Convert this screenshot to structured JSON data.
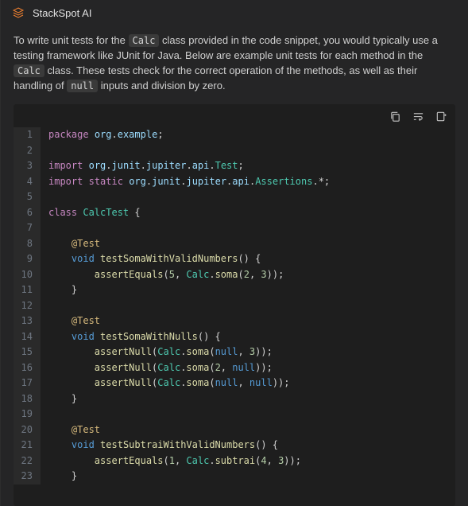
{
  "header": {
    "title": "StackSpot AI"
  },
  "description": {
    "t1": "To write unit tests for the ",
    "c1": "Calc",
    "t2": " class provided in the code snippet, you would typically use a testing framework like JUnit for Java. Below are example unit tests for each method in the ",
    "c2": "Calc",
    "t3": " class. These tests check for the correct operation of the methods, as well as their handling of ",
    "c3": "null",
    "t4": " inputs and division by zero."
  },
  "chart_data": {
    "type": "table",
    "language": "java",
    "lines": [
      {
        "n": 1,
        "tokens": [
          [
            "package",
            "kw"
          ],
          [
            " ",
            "p"
          ],
          [
            "org",
            "pkg"
          ],
          [
            ".",
            "p"
          ],
          [
            "example",
            "pkg"
          ],
          [
            ";",
            "p"
          ]
        ]
      },
      {
        "n": 2,
        "tokens": []
      },
      {
        "n": 3,
        "tokens": [
          [
            "import",
            "kw"
          ],
          [
            " ",
            "p"
          ],
          [
            "org",
            "pkg"
          ],
          [
            ".",
            "p"
          ],
          [
            "junit",
            "pkg"
          ],
          [
            ".",
            "p"
          ],
          [
            "jupiter",
            "pkg"
          ],
          [
            ".",
            "p"
          ],
          [
            "api",
            "pkg"
          ],
          [
            ".",
            "p"
          ],
          [
            "Test",
            "cls"
          ],
          [
            ";",
            "p"
          ]
        ]
      },
      {
        "n": 4,
        "tokens": [
          [
            "import",
            "kw"
          ],
          [
            " ",
            "p"
          ],
          [
            "static",
            "kw"
          ],
          [
            " ",
            "p"
          ],
          [
            "org",
            "pkg"
          ],
          [
            ".",
            "p"
          ],
          [
            "junit",
            "pkg"
          ],
          [
            ".",
            "p"
          ],
          [
            "jupiter",
            "pkg"
          ],
          [
            ".",
            "p"
          ],
          [
            "api",
            "pkg"
          ],
          [
            ".",
            "p"
          ],
          [
            "Assertions",
            "cls"
          ],
          [
            ".",
            "p"
          ],
          [
            "*",
            "star"
          ],
          [
            ";",
            "p"
          ]
        ]
      },
      {
        "n": 5,
        "tokens": []
      },
      {
        "n": 6,
        "tokens": [
          [
            "class",
            "kw"
          ],
          [
            " ",
            "p"
          ],
          [
            "CalcTest",
            "cls"
          ],
          [
            " {",
            "p"
          ]
        ]
      },
      {
        "n": 7,
        "tokens": []
      },
      {
        "n": 8,
        "tokens": [
          [
            "    ",
            "p"
          ],
          [
            "@Test",
            "ann"
          ]
        ]
      },
      {
        "n": 9,
        "tokens": [
          [
            "    ",
            "p"
          ],
          [
            "void",
            "lit"
          ],
          [
            " ",
            "p"
          ],
          [
            "testSomaWithValidNumbers",
            "fn"
          ],
          [
            "() {",
            "p"
          ]
        ]
      },
      {
        "n": 10,
        "tokens": [
          [
            "        ",
            "p"
          ],
          [
            "assertEquals",
            "fn"
          ],
          [
            "(",
            "p"
          ],
          [
            "5",
            "num"
          ],
          [
            ", ",
            "p"
          ],
          [
            "Calc",
            "cls"
          ],
          [
            ".",
            "p"
          ],
          [
            "soma",
            "fn"
          ],
          [
            "(",
            "p"
          ],
          [
            "2",
            "num"
          ],
          [
            ", ",
            "p"
          ],
          [
            "3",
            "num"
          ],
          [
            "));",
            "p"
          ]
        ]
      },
      {
        "n": 11,
        "tokens": [
          [
            "    }",
            "p"
          ]
        ]
      },
      {
        "n": 12,
        "tokens": []
      },
      {
        "n": 13,
        "tokens": [
          [
            "    ",
            "p"
          ],
          [
            "@Test",
            "ann"
          ]
        ]
      },
      {
        "n": 14,
        "tokens": [
          [
            "    ",
            "p"
          ],
          [
            "void",
            "lit"
          ],
          [
            " ",
            "p"
          ],
          [
            "testSomaWithNulls",
            "fn"
          ],
          [
            "() {",
            "p"
          ]
        ]
      },
      {
        "n": 15,
        "tokens": [
          [
            "        ",
            "p"
          ],
          [
            "assertNull",
            "fn"
          ],
          [
            "(",
            "p"
          ],
          [
            "Calc",
            "cls"
          ],
          [
            ".",
            "p"
          ],
          [
            "soma",
            "fn"
          ],
          [
            "(",
            "p"
          ],
          [
            "null",
            "lit"
          ],
          [
            ", ",
            "p"
          ],
          [
            "3",
            "num"
          ],
          [
            "));",
            "p"
          ]
        ]
      },
      {
        "n": 16,
        "tokens": [
          [
            "        ",
            "p"
          ],
          [
            "assertNull",
            "fn"
          ],
          [
            "(",
            "p"
          ],
          [
            "Calc",
            "cls"
          ],
          [
            ".",
            "p"
          ],
          [
            "soma",
            "fn"
          ],
          [
            "(",
            "p"
          ],
          [
            "2",
            "num"
          ],
          [
            ", ",
            "p"
          ],
          [
            "null",
            "lit"
          ],
          [
            "));",
            "p"
          ]
        ]
      },
      {
        "n": 17,
        "tokens": [
          [
            "        ",
            "p"
          ],
          [
            "assertNull",
            "fn"
          ],
          [
            "(",
            "p"
          ],
          [
            "Calc",
            "cls"
          ],
          [
            ".",
            "p"
          ],
          [
            "soma",
            "fn"
          ],
          [
            "(",
            "p"
          ],
          [
            "null",
            "lit"
          ],
          [
            ", ",
            "p"
          ],
          [
            "null",
            "lit"
          ],
          [
            "));",
            "p"
          ]
        ]
      },
      {
        "n": 18,
        "tokens": [
          [
            "    }",
            "p"
          ]
        ]
      },
      {
        "n": 19,
        "tokens": []
      },
      {
        "n": 20,
        "tokens": [
          [
            "    ",
            "p"
          ],
          [
            "@Test",
            "ann"
          ]
        ]
      },
      {
        "n": 21,
        "tokens": [
          [
            "    ",
            "p"
          ],
          [
            "void",
            "lit"
          ],
          [
            " ",
            "p"
          ],
          [
            "testSubtraiWithValidNumbers",
            "fn"
          ],
          [
            "() {",
            "p"
          ]
        ]
      },
      {
        "n": 22,
        "tokens": [
          [
            "        ",
            "p"
          ],
          [
            "assertEquals",
            "fn"
          ],
          [
            "(",
            "p"
          ],
          [
            "1",
            "num"
          ],
          [
            ", ",
            "p"
          ],
          [
            "Calc",
            "cls"
          ],
          [
            ".",
            "p"
          ],
          [
            "subtrai",
            "fn"
          ],
          [
            "(",
            "p"
          ],
          [
            "4",
            "num"
          ],
          [
            ", ",
            "p"
          ],
          [
            "3",
            "num"
          ],
          [
            "));",
            "p"
          ]
        ]
      },
      {
        "n": 23,
        "tokens": [
          [
            "    }",
            "p"
          ]
        ]
      }
    ]
  },
  "toolbar": {
    "copy": "copy",
    "wrap": "word-wrap",
    "insert": "insert"
  }
}
